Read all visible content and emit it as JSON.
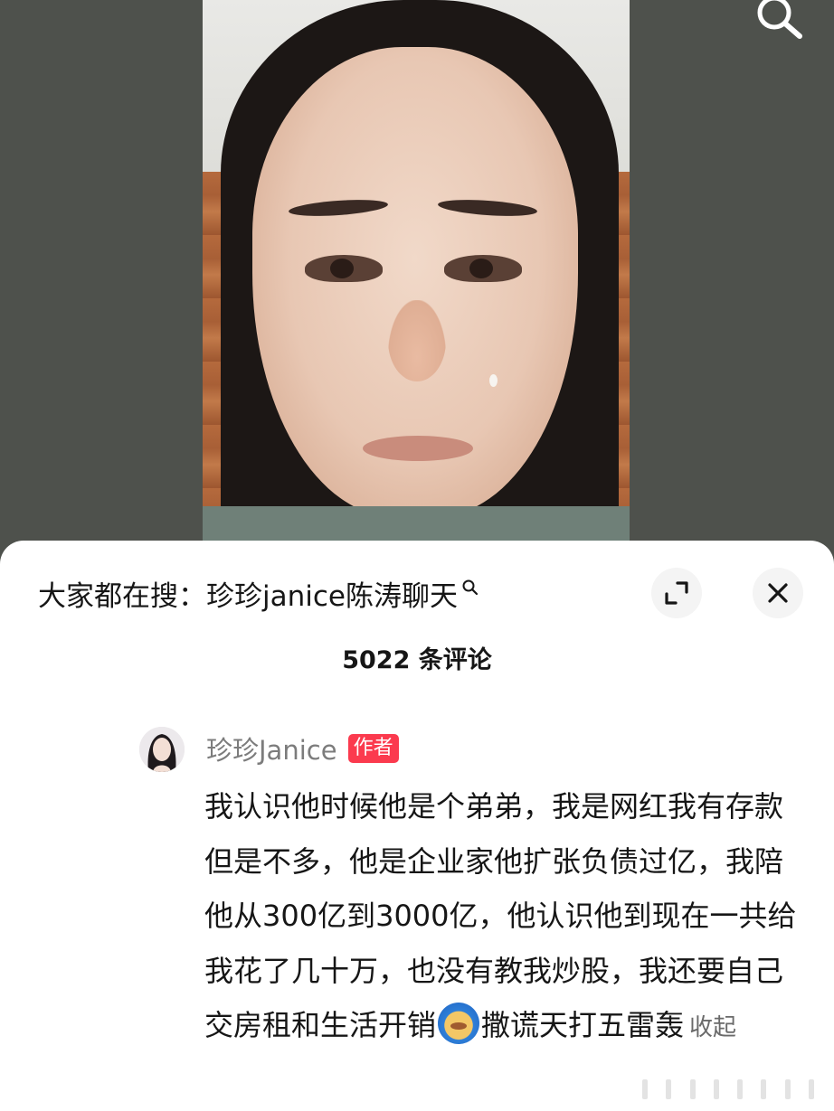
{
  "header": {
    "search_icon": "search-icon"
  },
  "sheet": {
    "suggest_prefix": "大家都在搜：",
    "suggest_query": "珍珍janice陈涛聊天",
    "suggest_icon": "search-icon",
    "expand_icon": "expand-icon",
    "close_icon": "close-icon",
    "comment_count": "5022 条评论"
  },
  "comment": {
    "author": "珍珍Janice",
    "badge": "作者",
    "text_main": "我认识他时候他是个弟弟，我是网红我有存款但是不多，他是企业家他扩张负债过亿，我陪他从300亿到3000亿，他认识他到现在一共给我花了几十万，也没有教我炒股，我还要自己交房租和生活开销",
    "emoji": "crying-emoji",
    "text_tail": "撒谎天打五雷轰",
    "collapse_label": "收起"
  },
  "colors": {
    "badge": "#fb3a4e",
    "text": "#161616",
    "muted": "#7c7c7c"
  }
}
